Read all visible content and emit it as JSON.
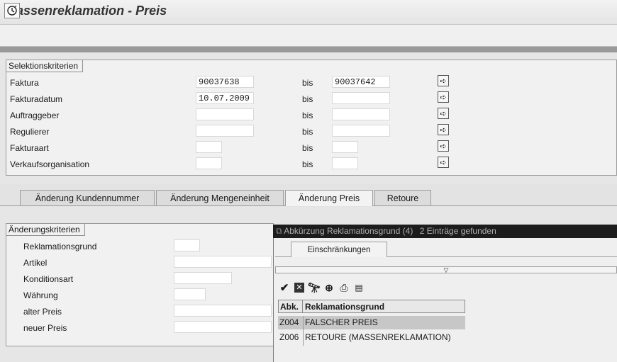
{
  "window": {
    "title": "Massenreklamation - Preis"
  },
  "toolbar": {
    "execute_icon": "execute-clock-icon"
  },
  "selection": {
    "section_label": "Selektionskriterien",
    "bis_label": "bis",
    "rows": [
      {
        "label": "Faktura",
        "from": "90037638",
        "to": "90037642"
      },
      {
        "label": "Fakturadatum",
        "from": "10.07.2009",
        "to": ""
      },
      {
        "label": "Auftraggeber",
        "from": "",
        "to": ""
      },
      {
        "label": "Regulierer",
        "from": "",
        "to": ""
      },
      {
        "label": "Fakturaart",
        "from": "",
        "to": ""
      },
      {
        "label": "Verkaufsorganisation",
        "from": "",
        "to": ""
      }
    ]
  },
  "tabs": [
    {
      "label": "Änderung Kundennummer",
      "active": false
    },
    {
      "label": "Änderung Mengeneinheit",
      "active": false
    },
    {
      "label": "Änderung Preis",
      "active": true
    },
    {
      "label": "Retoure",
      "active": false
    }
  ],
  "change_criteria": {
    "section_label": "Änderungskriterien",
    "fields": [
      {
        "label": "Reklamationsgrund",
        "value": ""
      },
      {
        "label": "Artikel",
        "value": ""
      },
      {
        "label": "Konditionsart",
        "value": ""
      },
      {
        "label": "Währung",
        "value": ""
      },
      {
        "label": "alter Preis",
        "value": ""
      },
      {
        "label": "neuer Preis",
        "value": ""
      }
    ]
  },
  "popup": {
    "title": "Abkürzung Reklamationsgrund (4)",
    "count": "2 Einträge gefunden",
    "tab_label": "Einschränkungen",
    "columns": [
      "Abk.",
      "Reklamationsgrund"
    ],
    "rows": [
      {
        "abk": "Z004",
        "grund": "FALSCHER PREIS"
      },
      {
        "abk": "Z006",
        "grund": "RETOURE (MASSENREKLAMATION)"
      }
    ]
  }
}
